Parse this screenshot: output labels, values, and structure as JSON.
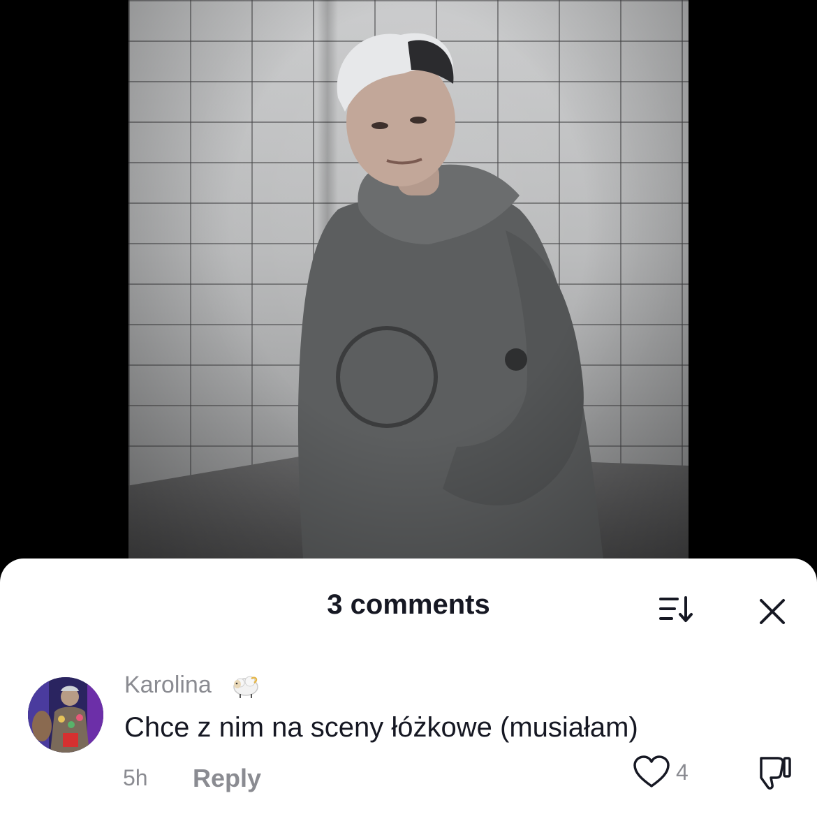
{
  "video": {
    "description_icon": "video-frame"
  },
  "comments_sheet": {
    "title": "3 comments",
    "sort_icon": "sort-icon",
    "close_icon": "close-icon"
  },
  "comments": [
    {
      "username": "Karolina",
      "badge_icon": "sheep-emoji-icon",
      "text": "Chce z nim na sceny łóżkowe (musiałam)",
      "time": "5h",
      "reply_label": "Reply",
      "likes": "4",
      "like_icon": "heart-outline-icon",
      "dislike_icon": "thumbs-down-icon"
    }
  ],
  "colors": {
    "sheet_background": "#ffffff",
    "primary_text": "#161823",
    "secondary_text": "#8a8b91",
    "backdrop": "#000000"
  }
}
